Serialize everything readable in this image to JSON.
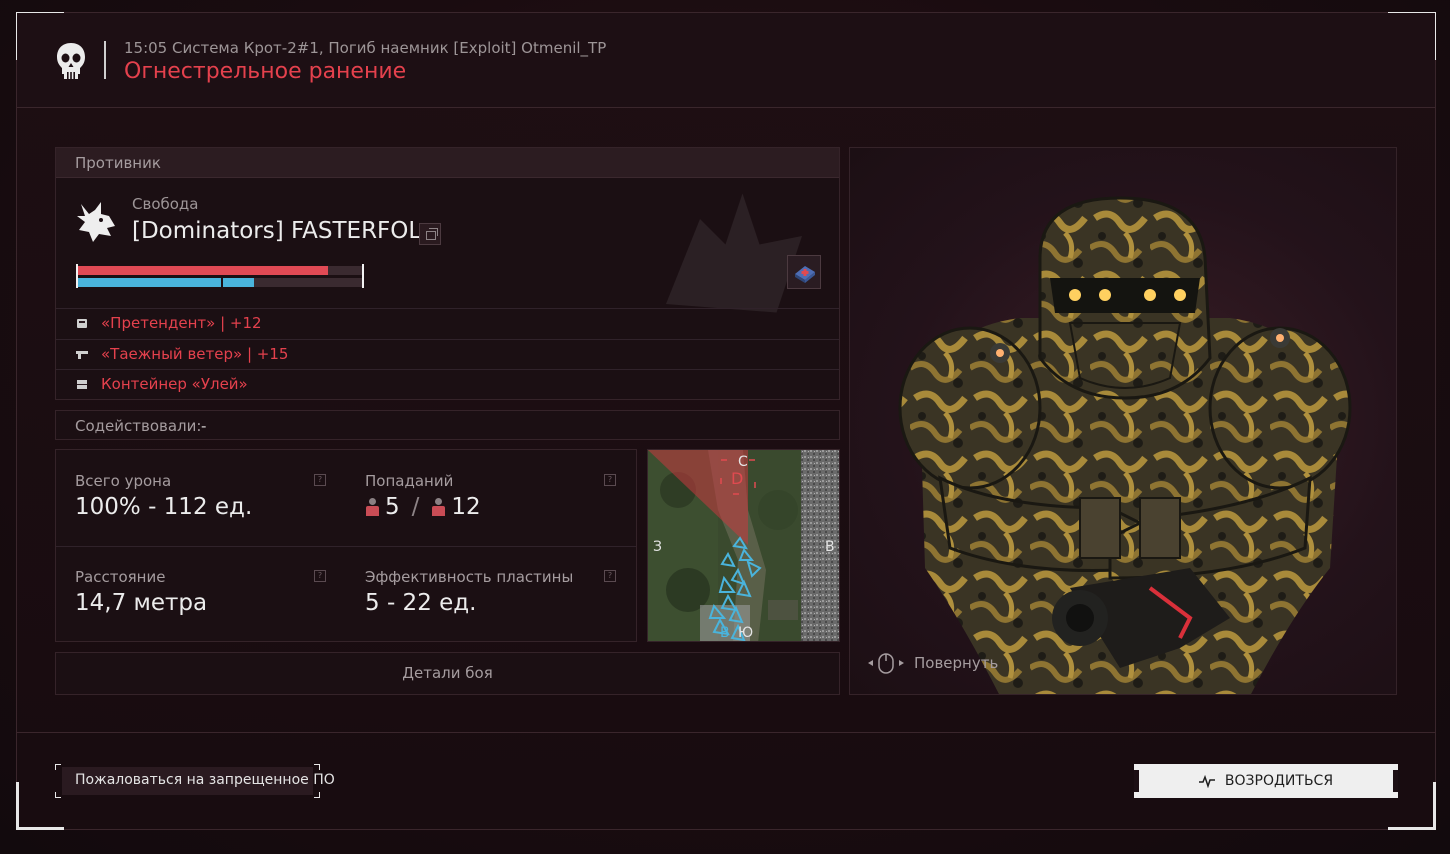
{
  "header": {
    "meta": "15:05 Система Крот-2#1, Погиб наемник [Exploit] Otmenil_TP",
    "title": "Огнестрельное ранение"
  },
  "enemy": {
    "section_label": "Противник",
    "faction": "Свобода",
    "name": "[Dominators] FASTERFOL",
    "health_fraction": 0.88,
    "armor_fraction": 0.62,
    "equipment": [
      {
        "icon": "armor-icon",
        "text": "«Претендент» | +12"
      },
      {
        "icon": "rifle-icon",
        "text": "«Таежный ветер» | +15"
      },
      {
        "icon": "container-icon",
        "text": "Контейнер «Улей»"
      }
    ]
  },
  "assist": {
    "label": "Содействовали:",
    "value": "-"
  },
  "stats": {
    "damage_label": "Всего урона",
    "damage_value": "100% - 112 ед.",
    "hits_label": "Попаданий",
    "hits_left": "5",
    "hits_sep": "/",
    "hits_right": "12",
    "distance_label": "Расстояние",
    "distance_value": "14,7 метра",
    "plate_label": "Эффективность пластины",
    "plate_value": "5 - 22 ед.",
    "help_glyph": "?"
  },
  "minimap": {
    "north": "С",
    "south": "Ю",
    "west": "З",
    "east": "В",
    "point": "D",
    "marker": "B"
  },
  "details_button": "Детали боя",
  "rotate_hint": "Повернуть",
  "report_button": "Пожаловаться на запрещенное ПО",
  "respawn_button": "ВОЗРОДИТЬСЯ",
  "colors": {
    "accent_red": "#e4414d",
    "health": "#e14a55",
    "armor": "#4ab4dc"
  }
}
